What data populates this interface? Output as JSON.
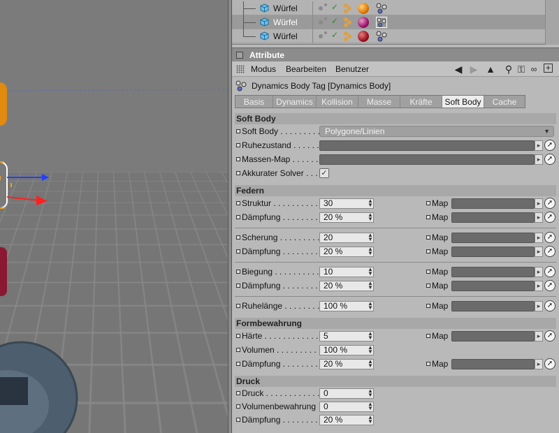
{
  "object_manager": {
    "rows": [
      {
        "name": "Würfel",
        "selected": false
      },
      {
        "name": "Würfel",
        "selected": true
      },
      {
        "name": "Würfel",
        "selected": false
      }
    ]
  },
  "attribute_manager": {
    "title": "Attribute",
    "menu": [
      "Modus",
      "Bearbeiten",
      "Benutzer"
    ],
    "tag_title": "Dynamics Body Tag [Dynamics Body]",
    "tabs": [
      {
        "label": "Basis",
        "active": false
      },
      {
        "label": "Dynamics",
        "active": false
      },
      {
        "label": "Kollision",
        "active": false
      },
      {
        "label": "Masse",
        "active": false
      },
      {
        "label": "Kräfte",
        "active": false
      },
      {
        "label": "Soft Body",
        "active": true
      },
      {
        "label": "Cache",
        "active": false
      }
    ],
    "soft_body": {
      "heading": "Soft Body",
      "soft_body_label": "Soft Body . . . . . . . . .",
      "soft_body_value": "Polygone/Linien",
      "ruhezustand_label": "Ruhezustand . . . . . .",
      "massen_map_label": "Massen-Map . . . . . .",
      "akkurater_solver_label": "Akkurater Solver . . .",
      "akkurater_solver_checked": true
    },
    "federn": {
      "heading": "Federn",
      "struktur_label": "Struktur . . . . . . . . . . .",
      "struktur_value": "30",
      "daempfung1_label": "Dämpfung . . . . . . . . .",
      "daempfung1_value": "20 %",
      "scherung_label": "Scherung . . . . . . . . .",
      "scherung_value": "20",
      "daempfung2_label": "Dämpfung . . . . . . . . .",
      "daempfung2_value": "20 %",
      "biegung_label": "Biegung . . . . . . . . . .",
      "biegung_value": "10",
      "daempfung3_label": "Dämpfung . . . . . . . . .",
      "daempfung3_value": "20 %",
      "ruhelaenge_label": "Ruhelänge . . . . . . . .",
      "ruhelaenge_value": "100 %",
      "map_label": "Map"
    },
    "formbewahrung": {
      "heading": "Formbewahrung",
      "haerte_label": "Härte . . . . . . . . . . . . .",
      "haerte_value": "5",
      "volumen_label": "Volumen . . . . . . . . . .",
      "volumen_value": "100 %",
      "daempfung_label": "Dämpfung . . . . . . . . .",
      "daempfung_value": "20 %",
      "map_label": "Map"
    },
    "druck": {
      "heading": "Druck",
      "druck_label": "Druck . . . . . . . . . . . .",
      "druck_value": "0",
      "volumenbewahrung_label": "Volumenbewahrung",
      "volumenbewahrung_value": "0",
      "daempfung_label": "Dämpfung . . . . . . . . .",
      "daempfung_value": "20 %"
    }
  },
  "colors": {
    "panel_bg": "#b9b9b9",
    "tab_active": "#ececec",
    "field_dark": "#6b6b6b",
    "accent_check": "#2b8a2b"
  }
}
